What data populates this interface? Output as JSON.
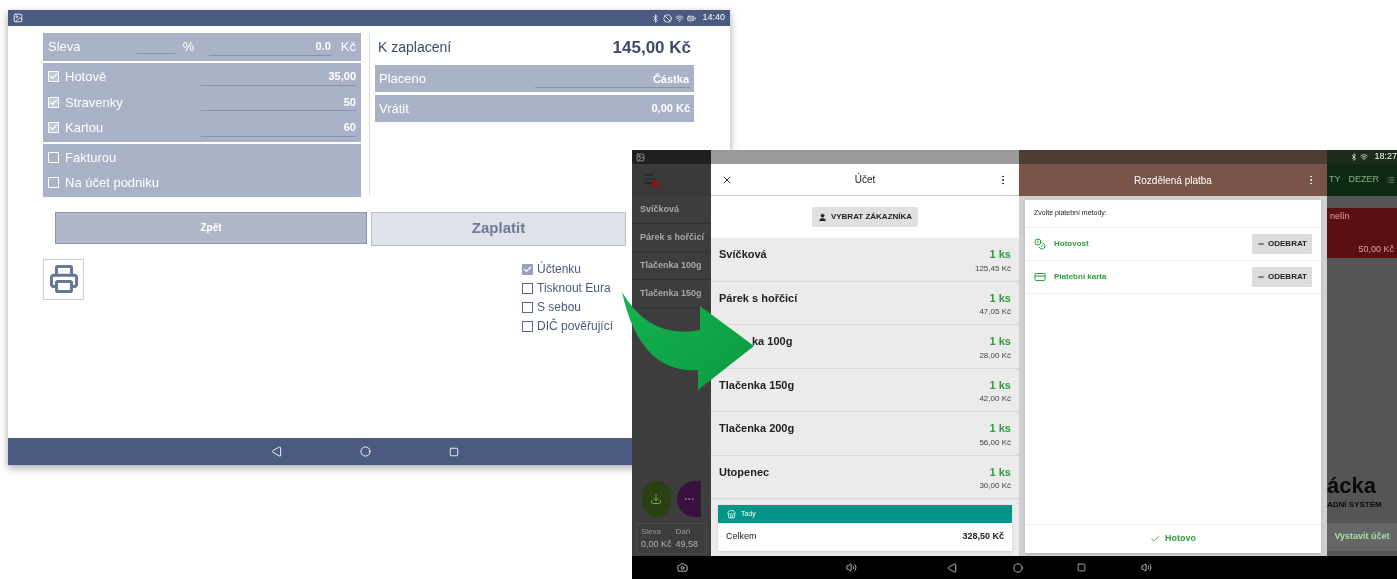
{
  "payment_screen": {
    "status_bar": {
      "time": "14:40"
    },
    "discount": {
      "label": "Sleva",
      "percent_unit": "%",
      "amount": "0.0",
      "currency": "Kč"
    },
    "method_groups": [
      {
        "items": [
          {
            "label": "Hotově",
            "checked": true,
            "amount": "35,00"
          },
          {
            "label": "Stravenky",
            "checked": true,
            "amount": "50"
          },
          {
            "label": "Kartou",
            "checked": true,
            "amount": "60"
          }
        ]
      },
      {
        "items": [
          {
            "label": "Fakturou",
            "checked": false
          },
          {
            "label": "Na účet podniku",
            "checked": false
          }
        ]
      }
    ],
    "to_pay": {
      "label": "K zaplacení",
      "value": "145,00 Kč"
    },
    "paid": {
      "label": "Placeno",
      "placeholder": "Částka"
    },
    "change": {
      "label": "Vrátit",
      "value": "0,00 Kč"
    },
    "buttons": [
      {
        "label": "Zpět",
        "kind": "back"
      },
      {
        "label": "Zaplatit",
        "kind": "pay"
      }
    ],
    "print_options": [
      {
        "label": "Účtenku",
        "checked": true
      },
      {
        "label": "Tisknout Eura",
        "checked": false
      },
      {
        "label": "S sebou",
        "checked": false
      },
      {
        "label": "DIČ pověřující",
        "checked": false
      }
    ]
  },
  "order_screen": {
    "status_bar": {
      "time": "18:27"
    },
    "sidebar": {
      "items": [
        "Svíčková",
        "Párek s hořčicí",
        "Tlačenka 100g",
        "Tlačenka 150g"
      ]
    },
    "summary": [
      {
        "label": "Sleva",
        "value": "0,00 Kč"
      },
      {
        "label": "Daň",
        "value": "49,58"
      }
    ],
    "bill": {
      "title": "Účet",
      "customer_button": "VYBRAT ZÁKAZNÍKA",
      "items": [
        {
          "name": "Svíčková",
          "quantity": "1 ks",
          "price": "125,45 Kč"
        },
        {
          "name": "Párek s hořčicí",
          "quantity": "1 ks",
          "price": "47,05 Kč"
        },
        {
          "name": "ka 100g",
          "quantity": "1 ks",
          "price": "28,00 Kč"
        },
        {
          "name": "Tlačenka 150g",
          "quantity": "1 ks",
          "price": "42,00 Kč"
        },
        {
          "name": "Tlačenka 200g",
          "quantity": "1 ks",
          "price": "56,00 Kč"
        },
        {
          "name": "Utopenec",
          "quantity": "1 ks",
          "price": "30,00 Kč"
        }
      ],
      "place": "Tady",
      "total_label": "Celkem",
      "total": "328,50 Kč"
    },
    "split_payment": {
      "title": "Rozdělená platba",
      "prompt": "Zvolte platební metody:",
      "methods": [
        {
          "name": "Hotovost",
          "kind": "cash",
          "action": "ODEBRAT"
        },
        {
          "name": "Platební karta",
          "kind": "card",
          "action": "ODEBRAT"
        }
      ],
      "done": "Hotovo"
    },
    "background": {
      "tabs": [
        "TY",
        "DEZER"
      ],
      "card": {
        "title": "nelín",
        "price": "50,00 Kč"
      },
      "logo": "ácka",
      "tagline": "ADNÍ SYSTÉM",
      "issue_button": "Vystavit účet"
    }
  }
}
